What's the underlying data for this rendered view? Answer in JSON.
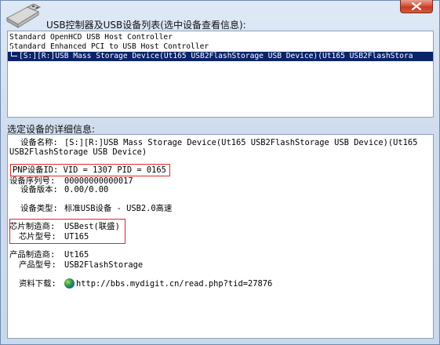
{
  "title": "USB控制器及USB设备列表(选中设备查看信息):",
  "device_list": [
    {
      "text": "Standard OpenHCD USB Host Controller",
      "selected": false
    },
    {
      "text": "Standard Enhanced PCI to USB Host Controller",
      "selected": false
    },
    {
      "text": "[S:][R:]USB Mass Storage Device(Ut165 USB2FlashStorage USB Device)(Ut165 USB2FlashStora",
      "selected": true
    }
  ],
  "details_label": "选定设备的详细信息:",
  "details": {
    "device_name_label": "设备名称:",
    "device_name_value": "[S:][R:]USB Mass Storage Device(Ut165 USB2FlashStorage USB Device)(Ut165",
    "device_name_cont": "USB2FlashStorage USB Device)",
    "pnp_id": "PNP设备ID: VID = 1307 PID = 0165",
    "serial_label": "设备序列号:",
    "serial_value": "00000000000017",
    "version_label": "设备版本:",
    "version_value": "0.00/0.00",
    "type_label": "设备类型:",
    "type_value": "标准USB设备 - USB2.0高速",
    "chip_vendor_label": "芯片制造商:",
    "chip_vendor_value": "USBest(联盛)",
    "chip_model_label": "芯片型号:",
    "chip_model_value": "UT165",
    "product_vendor_label": "产品制造商:",
    "product_vendor_value": "Ut165",
    "product_model_label": "产品型号:",
    "product_model_value": "USB2FlashStorage",
    "download_label": "资料下载:",
    "download_link": "http://bbs.mydigit.cn/read.php?tid=27876"
  },
  "colors": {
    "selection": "#0a246a",
    "highlight_box": "#e0262a"
  }
}
